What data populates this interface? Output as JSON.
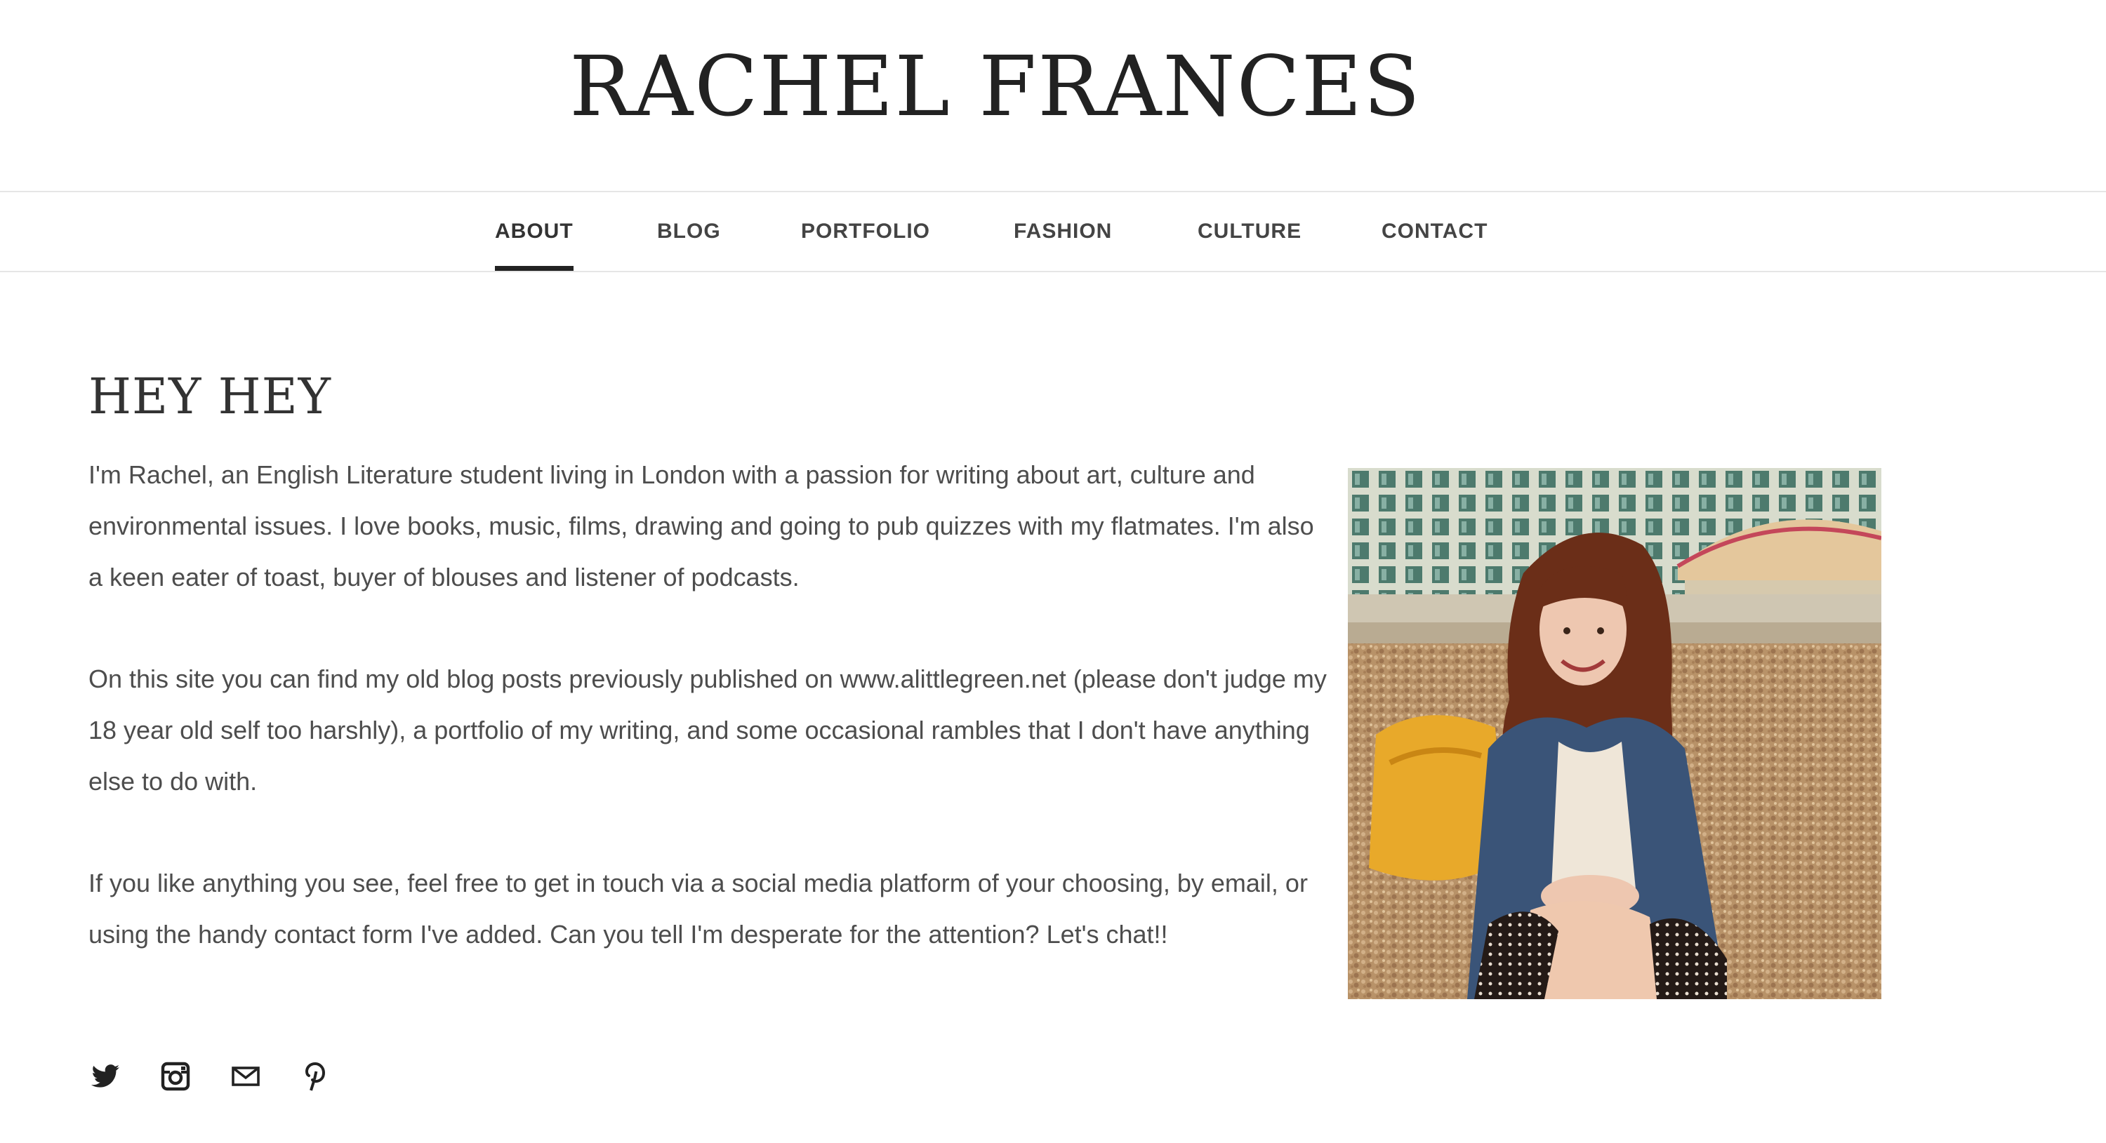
{
  "site": {
    "title": "RACHEL FRANCES"
  },
  "nav": {
    "items": [
      {
        "label": "ABOUT",
        "active": true
      },
      {
        "label": "BLOG",
        "active": false
      },
      {
        "label": "PORTFOLIO",
        "active": false
      },
      {
        "label": "FASHION",
        "active": false
      },
      {
        "label": "CULTURE",
        "active": false
      },
      {
        "label": "CONTACT",
        "active": false
      }
    ]
  },
  "page": {
    "heading": "HEY HEY",
    "paragraphs": [
      "I'm Rachel, an English Literature student living in London with a passion for writing about art, culture and environmental issues. I love books, music, films, drawing and going to pub quizzes with my flatmates. I'm also a keen eater of toast, buyer of blouses and listener of podcasts.",
      "On this site you can find my old blog posts previously published on www.alittlegreen.net (please don't judge my 18 year old self too harshly), a portfolio of my writing, and some occasional rambles that I don't have anything else to do with.",
      "If you like anything you see, feel free to get in touch via a social media platform of your choosing, by email, or using the handy contact form I've added. Can you tell I'm desperate for the attention? Let's chat!!"
    ]
  },
  "social": {
    "icons": [
      "twitter-icon",
      "instagram-icon",
      "email-icon",
      "pinterest-icon"
    ]
  },
  "colors": {
    "text": "#4d4d4d",
    "heading": "#333333",
    "nav_underline": "#222222",
    "divider": "#e6e6e6"
  }
}
